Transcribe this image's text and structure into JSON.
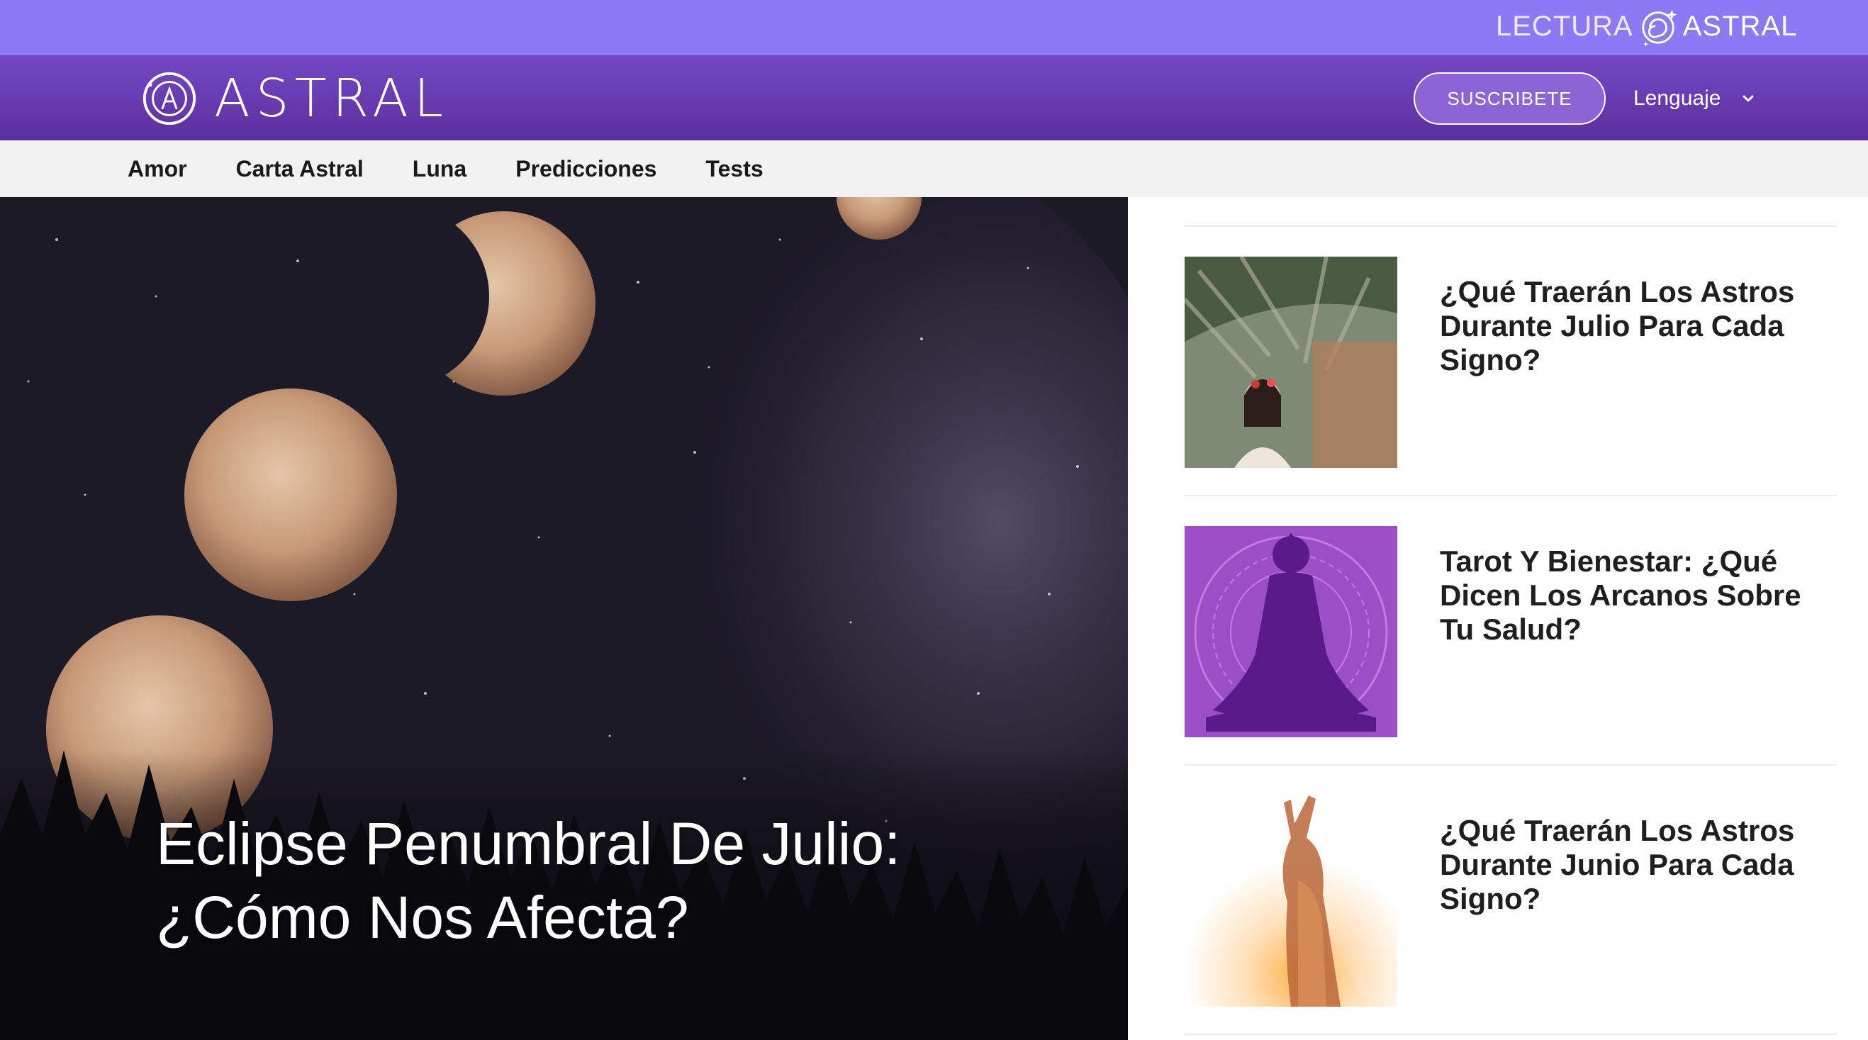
{
  "brand_strip": {
    "lectura_left": "LECTURA",
    "lectura_right": "ASTRAL"
  },
  "header": {
    "logo_text": "ASTRAL",
    "subscribe_label": "SUSCRIBETE",
    "language_label": "Lenguaje"
  },
  "nav": {
    "items": [
      "Amor",
      "Carta Astral",
      "Luna",
      "Predicciones",
      "Tests"
    ]
  },
  "hero": {
    "title": "Eclipse Penumbral De Julio: ¿Cómo Nos Afecta?"
  },
  "articles": [
    {
      "title": "¿Qué Traerán Los Astros Durante Julio Para Cada Signo?"
    },
    {
      "title": "Tarot Y Bienestar: ¿Qué Dicen Los Arcanos Sobre Tu Salud?"
    },
    {
      "title": "¿Qué Traerán Los Astros Durante Junio Para Cada Signo?"
    }
  ],
  "colors": {
    "strip": "#8d79f6",
    "header": "#6a3fb6",
    "nav_bg": "#f2f2f2",
    "accent_purple": "#9b4fc7"
  },
  "icons": [
    "lectura-astral-swirl-icon",
    "astral-logo-icon",
    "chevron-down-icon"
  ]
}
